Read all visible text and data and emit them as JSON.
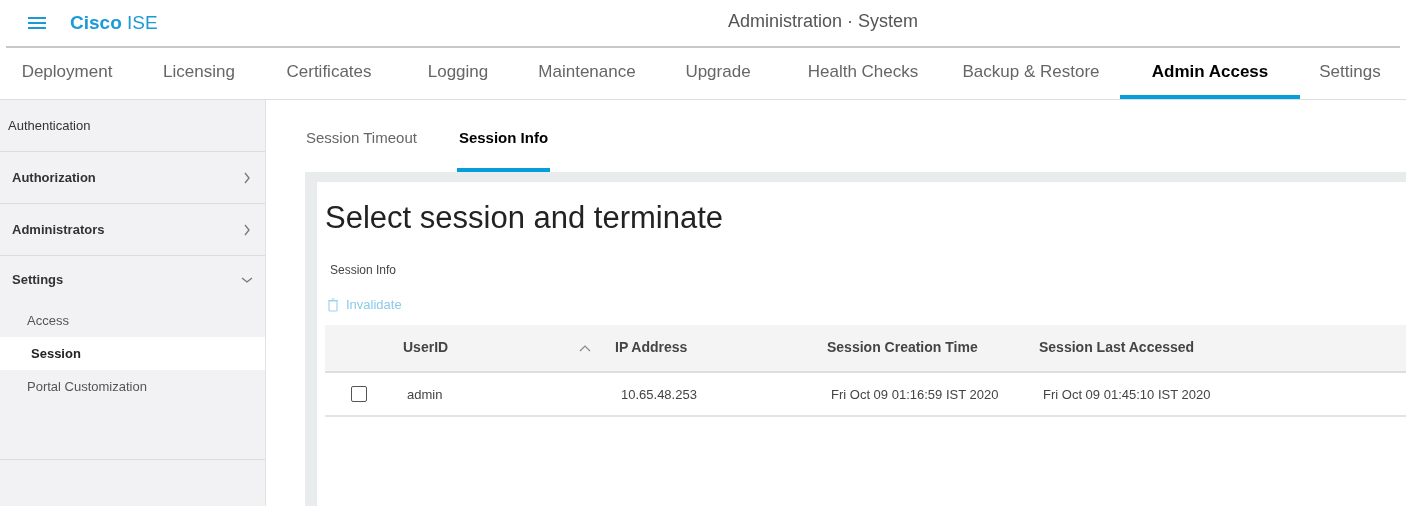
{
  "header": {
    "brand_bold": "Cisco",
    "brand_light": "ISE",
    "title": "Administration · System"
  },
  "tabs": [
    {
      "label": "Deployment",
      "selected": false
    },
    {
      "label": "Licensing",
      "selected": false
    },
    {
      "label": "Certificates",
      "selected": false
    },
    {
      "label": "Logging",
      "selected": false
    },
    {
      "label": "Maintenance",
      "selected": false
    },
    {
      "label": "Upgrade",
      "selected": false
    },
    {
      "label": "Health Checks",
      "selected": false
    },
    {
      "label": "Backup & Restore",
      "selected": false
    },
    {
      "label": "Admin Access",
      "selected": true
    },
    {
      "label": "Settings",
      "selected": false
    }
  ],
  "sidebar": {
    "items": [
      {
        "label": "Authentication",
        "kind": "link"
      },
      {
        "label": "Authorization",
        "kind": "group",
        "expanded": false
      },
      {
        "label": "Administrators",
        "kind": "group",
        "expanded": false
      },
      {
        "label": "Settings",
        "kind": "group",
        "expanded": true,
        "children": [
          {
            "label": "Access",
            "selected": false
          },
          {
            "label": "Session",
            "selected": true
          },
          {
            "label": "Portal Customization",
            "selected": false
          }
        ]
      }
    ]
  },
  "subtabs": [
    {
      "label": "Session Timeout",
      "selected": false
    },
    {
      "label": "Session Info",
      "selected": true
    }
  ],
  "panel": {
    "heading": "Select session and terminate",
    "section_label": "Session Info",
    "action": "Invalidate"
  },
  "table": {
    "columns": [
      {
        "label": "UserID",
        "sorted": true
      },
      {
        "label": "IP Address",
        "sorted": false
      },
      {
        "label": "Session Creation Time",
        "sorted": false
      },
      {
        "label": "Session Last Accessed",
        "sorted": false
      }
    ],
    "rows": [
      {
        "checked": false,
        "cells": [
          "admin",
          "10.65.48.253",
          "Fri Oct 09 01:16:59 IST 2020",
          "Fri Oct 09 01:45:10 IST 2020"
        ]
      }
    ]
  }
}
